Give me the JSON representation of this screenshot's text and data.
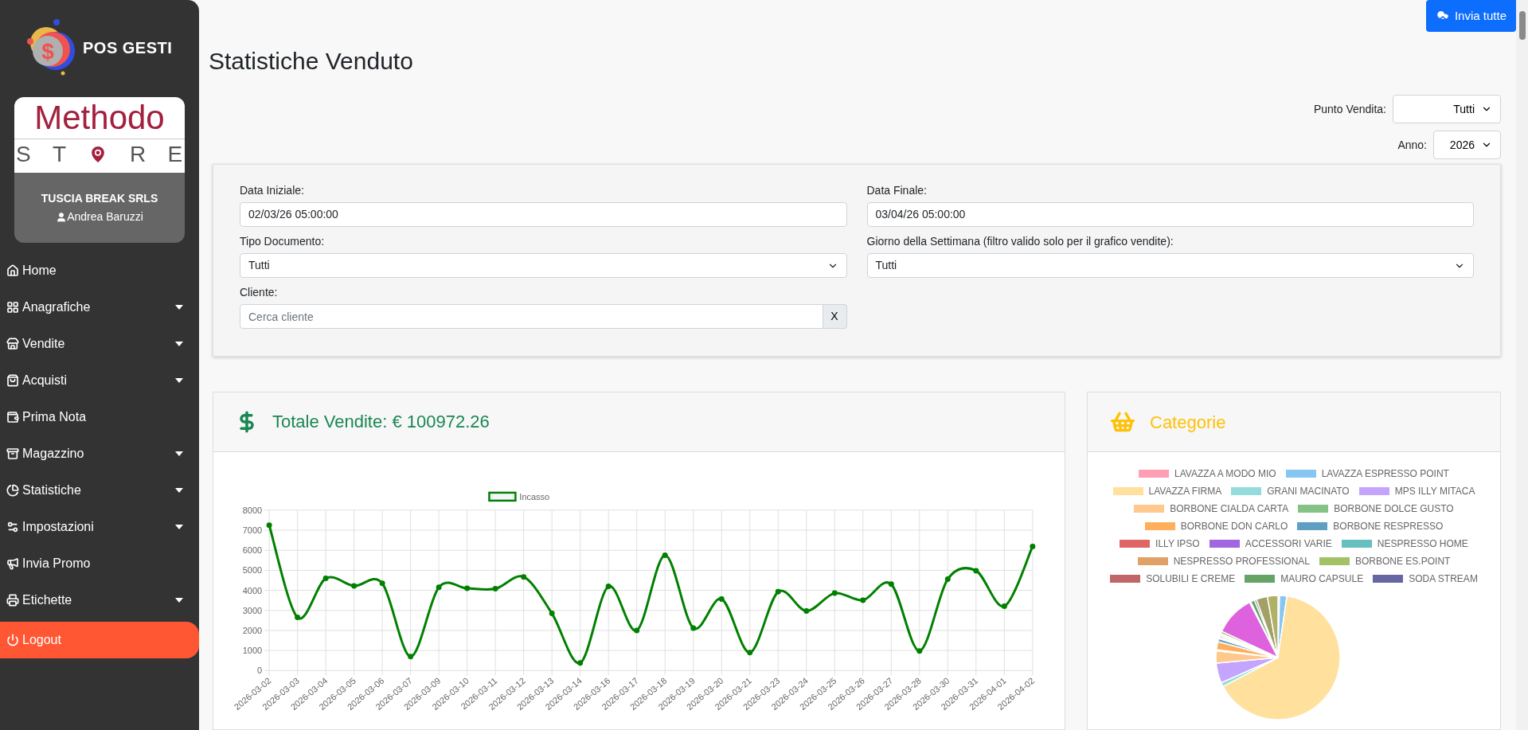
{
  "sidebar": {
    "logo_symbol": "$",
    "logo_text": "POS GESTI",
    "store_card": {
      "brand": "Methodo",
      "tagline_letters": [
        "S",
        "T",
        "R",
        "E"
      ],
      "company": "TUSCIA BREAK SRLS",
      "user": "Andrea Baruzzi"
    },
    "items": [
      {
        "label": "Home",
        "kind": "link",
        "expandable": false
      },
      {
        "label": "Anagrafiche",
        "kind": "link",
        "expandable": true
      },
      {
        "label": "Vendite",
        "kind": "link",
        "expandable": true
      },
      {
        "label": "Acquisti",
        "kind": "link",
        "expandable": true
      },
      {
        "label": "Prima Nota",
        "kind": "link",
        "expandable": false
      },
      {
        "label": "Magazzino",
        "kind": "link",
        "expandable": true
      },
      {
        "label": "Statistiche",
        "kind": "link",
        "expandable": true
      },
      {
        "label": "Impostazioni",
        "kind": "link",
        "expandable": true
      },
      {
        "label": "Invia Promo",
        "kind": "link",
        "expandable": false
      },
      {
        "label": "Etichette",
        "kind": "link",
        "expandable": true
      },
      {
        "label": "Logout",
        "kind": "logout",
        "expandable": false
      }
    ]
  },
  "top_button": "Invia tutte",
  "title": "Statistiche Venduto",
  "selectors": [
    {
      "label": "Punto Vendita:",
      "value": "Tutti"
    },
    {
      "label": "Anno:",
      "value": "2026"
    }
  ],
  "filters": {
    "fields": [
      {
        "label": "Data Iniziale:",
        "kind": "input",
        "value": "02/03/26 05:00:00"
      },
      {
        "label": "Data Finale:",
        "kind": "input",
        "value": "03/04/26 05:00:00"
      },
      {
        "label": "Tipo Documento:",
        "kind": "select",
        "value": "Tutti"
      },
      {
        "label": "Giorno della Settimana (filtro valido solo per il grafico vendite):",
        "kind": "select",
        "value": "Tutti"
      },
      {
        "label": "Cliente:",
        "kind": "search",
        "placeholder": "Cerca cliente",
        "button": "X"
      }
    ]
  },
  "sales_card": {
    "title": "Totale Vendite: € 100972.26",
    "chart_data": {
      "type": "line",
      "categories": [
        "2026-03-02",
        "2026-03-03",
        "2026-03-04",
        "2026-03-05",
        "2026-03-06",
        "2026-03-07",
        "2026-03-09",
        "2026-03-10",
        "2026-03-11",
        "2026-03-12",
        "2026-03-13",
        "2026-03-14",
        "2026-03-16",
        "2026-03-17",
        "2026-03-18",
        "2026-03-19",
        "2026-03-20",
        "2026-03-21",
        "2026-03-23",
        "2026-03-24",
        "2026-03-25",
        "2026-03-26",
        "2026-03-27",
        "2026-03-28",
        "2026-03-30",
        "2026-03-31",
        "2026-04-01",
        "2026-04-02"
      ],
      "series": [
        {
          "name": "Incasso",
          "color": "#008000",
          "values": [
            7250,
            2650,
            4600,
            4220,
            4350,
            700,
            4150,
            4100,
            4080,
            4670,
            2850,
            380,
            4200,
            2000,
            5750,
            2120,
            3570,
            900,
            3930,
            2970,
            3860,
            3510,
            4310,
            980,
            4560,
            4980,
            3210,
            6190
          ]
        }
      ],
      "grid": true,
      "marker": true,
      "ylim": [
        0,
        8000
      ],
      "yticks": [
        0,
        1000,
        2000,
        3000,
        4000,
        5000,
        6000,
        7000,
        8000
      ]
    }
  },
  "categories_card": {
    "title": "Categorie",
    "legend": [
      {
        "label": "LAVAZZA A MODO MIO",
        "color": "#ff9fb3"
      },
      {
        "label": "LAVAZZA ESPRESSO POINT",
        "color": "#86c6f3"
      },
      {
        "label": "LAVAZZA FIRMA",
        "color": "#ffe09c"
      },
      {
        "label": "GRANI MACINATO",
        "color": "#94dcdc"
      },
      {
        "label": "MPS ILLY MITACA",
        "color": "#c4a5fe"
      },
      {
        "label": "BORBONE CIALDA CARTA",
        "color": "#ffc88c"
      },
      {
        "label": "BORBONE DOLCE GUSTO",
        "color": "#84c285"
      },
      {
        "label": "BORBONE DON CARLO",
        "color": "#ffae5c"
      },
      {
        "label": "BORBONE RESPRESSO",
        "color": "#5fa0c2"
      },
      {
        "label": "ILLY IPSO",
        "color": "#e06666"
      },
      {
        "label": "ACCESSORI VARIE",
        "color": "#a266e0"
      },
      {
        "label": "NESPRESSO HOME",
        "color": "#66c0c0"
      },
      {
        "label": "NESPRESSO PROFESSIONAL",
        "color": "#e0a066"
      },
      {
        "label": "BORBONE ES.POINT",
        "color": "#a3c266"
      },
      {
        "label": "SOLUBILI E CREME",
        "color": "#c06666"
      },
      {
        "label": "MAURO CAPSULE",
        "color": "#66a366"
      },
      {
        "label": "SODA STREAM",
        "color": "#6666a3"
      }
    ]
  }
}
